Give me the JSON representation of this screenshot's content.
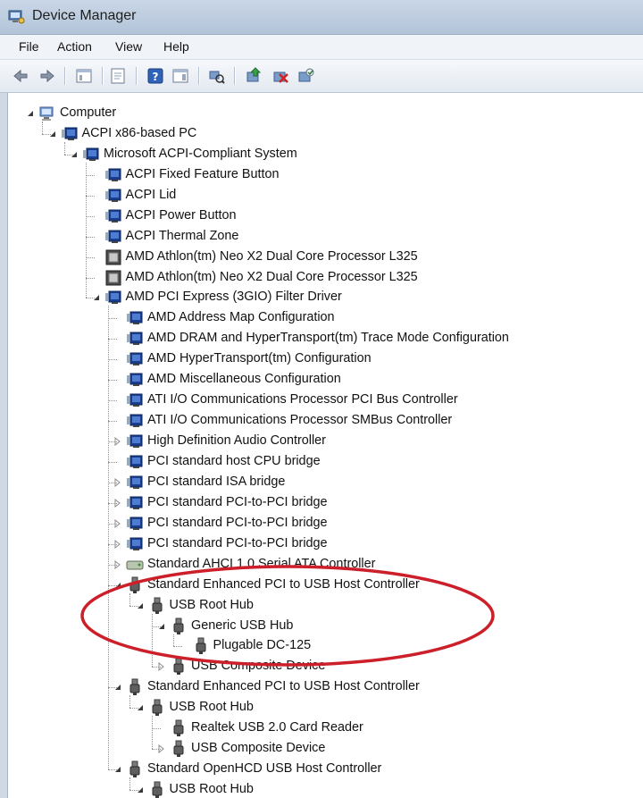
{
  "window": {
    "title": "Device Manager"
  },
  "menu": [
    "File",
    "Action",
    "View",
    "Help"
  ],
  "toolbar": [
    {
      "icon": "back-arrow-icon"
    },
    {
      "icon": "forward-arrow-icon"
    },
    {
      "icon": "sep"
    },
    {
      "icon": "console-tree-icon"
    },
    {
      "icon": "sep"
    },
    {
      "icon": "properties-sheet-icon"
    },
    {
      "icon": "sep"
    },
    {
      "icon": "help-icon"
    },
    {
      "icon": "action-pane-icon"
    },
    {
      "icon": "sep"
    },
    {
      "icon": "scan-hardware-icon"
    },
    {
      "icon": "sep"
    },
    {
      "icon": "update-driver-icon"
    },
    {
      "icon": "uninstall-icon"
    },
    {
      "icon": "enable-device-icon"
    }
  ],
  "tree": [
    {
      "label": "Computer",
      "level": 0,
      "expander": "open",
      "icon": "computer"
    },
    {
      "label": "ACPI x86-based PC",
      "level": 1,
      "expander": "open",
      "icon": "device"
    },
    {
      "label": "Microsoft ACPI-Compliant System",
      "level": 2,
      "expander": "open",
      "icon": "device"
    },
    {
      "label": "ACPI Fixed Feature Button",
      "level": 3,
      "expander": "none",
      "icon": "device"
    },
    {
      "label": "ACPI Lid",
      "level": 3,
      "expander": "none",
      "icon": "device"
    },
    {
      "label": "ACPI Power Button",
      "level": 3,
      "expander": "none",
      "icon": "device"
    },
    {
      "label": "ACPI Thermal Zone",
      "level": 3,
      "expander": "none",
      "icon": "device"
    },
    {
      "label": "AMD Athlon(tm) Neo X2 Dual Core Processor L325",
      "level": 3,
      "expander": "none",
      "icon": "processor"
    },
    {
      "label": "AMD Athlon(tm) Neo X2 Dual Core Processor L325",
      "level": 3,
      "expander": "none",
      "icon": "processor"
    },
    {
      "label": "AMD PCI Express (3GIO) Filter Driver",
      "level": 3,
      "expander": "open",
      "icon": "device"
    },
    {
      "label": "AMD Address Map Configuration",
      "level": 4,
      "expander": "none",
      "icon": "device"
    },
    {
      "label": "AMD DRAM and HyperTransport(tm) Trace Mode Configuration",
      "level": 4,
      "expander": "none",
      "icon": "device"
    },
    {
      "label": "AMD HyperTransport(tm) Configuration",
      "level": 4,
      "expander": "none",
      "icon": "device"
    },
    {
      "label": "AMD Miscellaneous Configuration",
      "level": 4,
      "expander": "none",
      "icon": "device"
    },
    {
      "label": "ATI I/O Communications Processor PCI Bus Controller",
      "level": 4,
      "expander": "none",
      "icon": "device"
    },
    {
      "label": "ATI I/O Communications Processor SMBus Controller",
      "level": 4,
      "expander": "none",
      "icon": "device"
    },
    {
      "label": "High Definition Audio Controller",
      "level": 4,
      "expander": "closed",
      "icon": "device"
    },
    {
      "label": "PCI standard host CPU bridge",
      "level": 4,
      "expander": "none",
      "icon": "device"
    },
    {
      "label": "PCI standard ISA bridge",
      "level": 4,
      "expander": "closed",
      "icon": "device"
    },
    {
      "label": "PCI standard PCI-to-PCI bridge",
      "level": 4,
      "expander": "closed",
      "icon": "device"
    },
    {
      "label": "PCI standard PCI-to-PCI bridge",
      "level": 4,
      "expander": "closed",
      "icon": "device"
    },
    {
      "label": "PCI standard PCI-to-PCI bridge",
      "level": 4,
      "expander": "closed",
      "icon": "device"
    },
    {
      "label": "Standard AHCI 1.0 Serial ATA Controller",
      "level": 4,
      "expander": "closed",
      "icon": "disk"
    },
    {
      "label": "Standard Enhanced PCI to USB Host Controller",
      "level": 4,
      "expander": "open",
      "icon": "usb"
    },
    {
      "label": "USB Root Hub",
      "level": 5,
      "expander": "open",
      "icon": "usb"
    },
    {
      "label": "Generic USB Hub",
      "level": 6,
      "expander": "open",
      "icon": "usb"
    },
    {
      "label": "Plugable DC-125",
      "level": 7,
      "expander": "none",
      "icon": "usb"
    },
    {
      "label": "USB Composite Device",
      "level": 6,
      "expander": "closed",
      "icon": "usb"
    },
    {
      "label": "Standard Enhanced PCI to USB Host Controller",
      "level": 4,
      "expander": "open",
      "icon": "usb"
    },
    {
      "label": "USB Root Hub",
      "level": 5,
      "expander": "open",
      "icon": "usb"
    },
    {
      "label": "Realtek USB 2.0 Card Reader",
      "level": 6,
      "expander": "none",
      "icon": "usb"
    },
    {
      "label": "USB Composite Device",
      "level": 6,
      "expander": "closed",
      "icon": "usb"
    },
    {
      "label": "Standard OpenHCD USB Host Controller",
      "level": 4,
      "expander": "open",
      "icon": "usb"
    },
    {
      "label": "USB Root Hub",
      "level": 5,
      "expander": "open",
      "icon": "usb"
    }
  ],
  "colors": {
    "annotation": "#cc1f2a",
    "selection_bg": "#ffffff",
    "tree_text": "#111111"
  }
}
